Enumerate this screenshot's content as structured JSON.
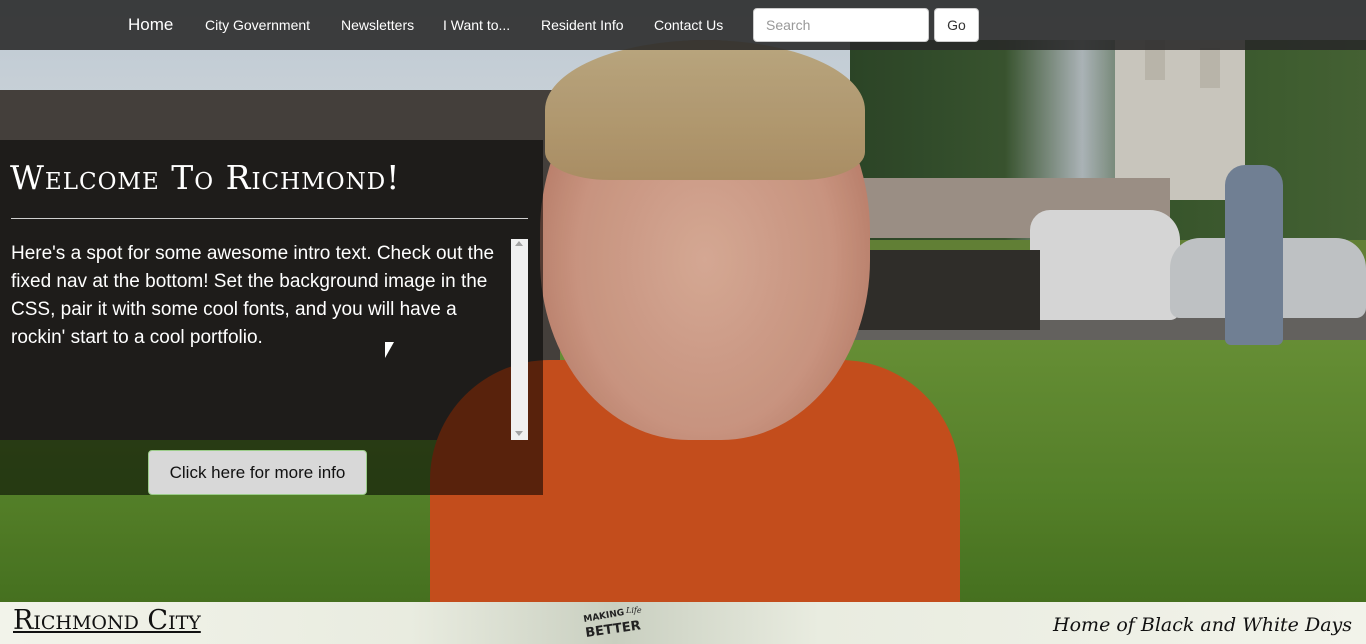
{
  "nav": {
    "items": [
      "Home",
      "City Government",
      "Newsletters",
      "I Want to...",
      "Resident Info",
      "Contact Us"
    ],
    "search_placeholder": "Search",
    "go_label": "Go"
  },
  "welcome": {
    "title": "Welcome To Richmond!",
    "intro": "Here's a spot for some awesome intro text. Check out the fixed nav at the bottom! Set the background image in the CSS, pair it with some cool fonts, and you will have a rockin' start to a cool portfolio.",
    "button_label": "Click here for more info"
  },
  "footer": {
    "title": "Richmond City",
    "logo_text": "MAKING Life BETTER",
    "tagline": "Home of Black and White Days"
  },
  "colors": {
    "navbar": "#282828",
    "panel": "#000000",
    "button_border": "#9ccd8a"
  }
}
